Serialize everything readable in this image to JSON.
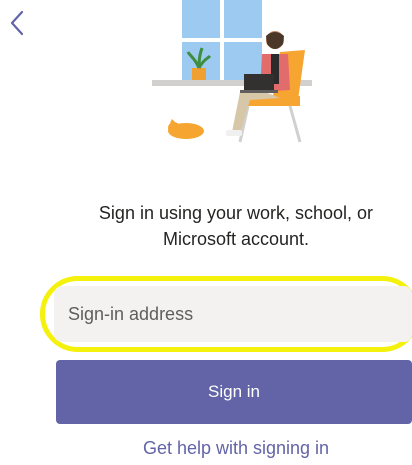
{
  "instruction": {
    "line1": "Sign in using your work, school, or",
    "line2": "Microsoft account."
  },
  "signin_field": {
    "placeholder": "Sign-in address"
  },
  "signin_button": {
    "label": "Sign in"
  },
  "help_link": {
    "label": "Get help with signing in"
  },
  "icons": {
    "back": "chevron-left-icon"
  },
  "colors": {
    "accent": "#6264a7",
    "highlight": "#f4f10c",
    "field_bg": "#f3f2f1",
    "text": "#252423"
  }
}
